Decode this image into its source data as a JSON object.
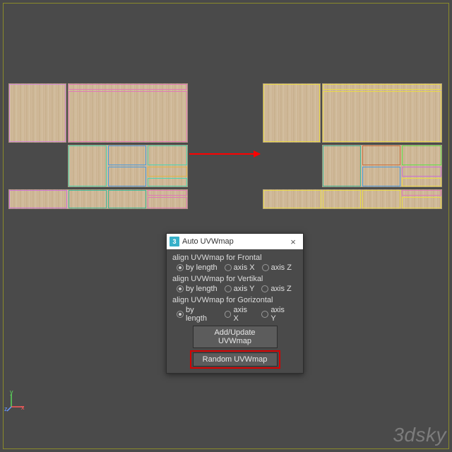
{
  "dialog": {
    "title": "Auto UVWmap",
    "icon_text": "3",
    "close": "×",
    "groups": [
      {
        "label": "align UVWmap for Frontal",
        "options": [
          "by length",
          "axis X",
          "axis Z"
        ]
      },
      {
        "label": "align UVWmap for Vertikal",
        "options": [
          "by length",
          "axis Y",
          "axis Z"
        ]
      },
      {
        "label": "align UVWmap for Gorizontal",
        "options": [
          "by length",
          "axis X",
          "axis Y"
        ]
      }
    ],
    "add_button": "Add/Update UVWmap",
    "random_button": "Random UVWmap"
  },
  "gizmo": {
    "x": "x",
    "y": "y",
    "z": "z"
  },
  "watermark": "3dsky"
}
